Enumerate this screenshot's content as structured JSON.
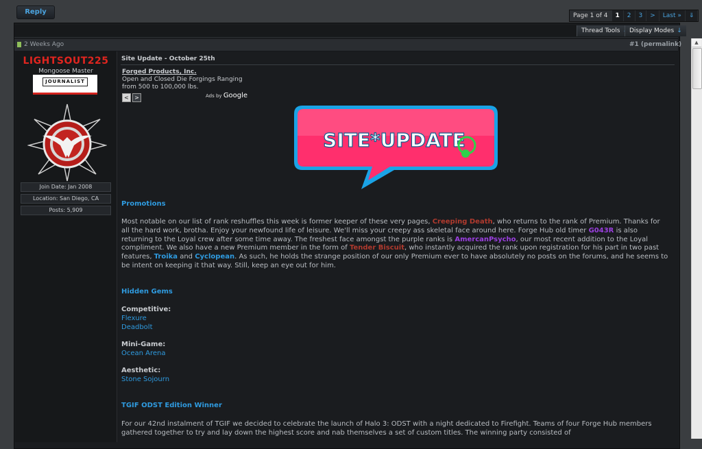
{
  "toolbar": {
    "reply_label": "Reply"
  },
  "pagination": {
    "label": "Page 1 of 4",
    "current": "1",
    "pages": [
      "2",
      "3"
    ],
    "next": ">",
    "last": "Last »",
    "menu": "⇓"
  },
  "thread_toolbar": {
    "thread_tools": "Thread Tools",
    "display_modes": "Display Modes",
    "arrow": "↓"
  },
  "post": {
    "date": "2 Weeks Ago",
    "permalink": "#1 (permalink)",
    "title": "Site Update - October 25th",
    "author": {
      "name": "LIGHTSOUT225",
      "title": "Mongoose Master",
      "badge": "JOURNALIST",
      "join_date": "Join Date: Jan 2008",
      "location": "Location: San Diego, CA",
      "posts": "Posts: 5,909"
    }
  },
  "ad": {
    "title": "Forged Products, Inc.",
    "line1": "Open and Closed Die Forgings Ranging",
    "line2": "from 500 to 100,000 lbs.",
    "prev": "<",
    "next": ">",
    "ads_by": "Ads by",
    "ads_brand": "Google"
  },
  "banner": {
    "text": "SITE*UPDATE"
  },
  "content": {
    "promotions_heading": "Promotions",
    "promo_1": "Most notable on our list of rank reshuffles this week is former keeper of these very pages, ",
    "promo_user1": "Creeping Death",
    "promo_2": ", who returns to the rank of Premium. Thanks for all the hard work, brotha. Enjoy your newfound life of leisure. We'll miss your creepy ass skeletal face around here. Forge Hub old timer ",
    "promo_user2": "G043R",
    "promo_3": " is also returning to the Loyal crew after some time away. The freshest face amongst the purple ranks is ",
    "promo_user3": "AmercanPsycho",
    "promo_4": ", our most recent addition to the Loyal compliment. We also have a new Premium member in the form of ",
    "promo_user4": "Tender Biscuit",
    "promo_5": ", who instantly acquired the rank upon registration for his part in two past features, ",
    "promo_user5": "Troika",
    "promo_6": " and ",
    "promo_user6": "Cyclopean",
    "promo_7": ". As such, he holds the strange position of our only Premium ever to have absolutely no posts on the forums, and he seems to be intent on keeping it that way. Still, keep an eye out for him.",
    "hidden_gems_heading": "Hidden Gems",
    "competitive_label": "Competitive:",
    "competitive_maps": [
      "Flexure",
      "Deadbolt"
    ],
    "minigame_label": "Mini-Game:",
    "minigame_maps": [
      "Ocean Arena"
    ],
    "aesthetic_label": "Aesthetic:",
    "aesthetic_maps": [
      "Stone Sojourn"
    ],
    "tgif_heading": "TGIF ODST Edition Winner",
    "tgif_para": "For our 42nd instalment of TGIF we decided to celebrate the launch of Halo 3: ODST with a night dedicated to Firefight. Teams of four Forge Hub members gathered together to try and lay down the highest score and nab themselves a set of custom titles. The winning party consisted of"
  },
  "colors": {
    "accent_blue": "#2f9be0",
    "username_red": "#e0251f",
    "purple": "#9b3fe0",
    "banner_pink": "#ff2f6d",
    "banner_blue": "#1aa3e6"
  }
}
